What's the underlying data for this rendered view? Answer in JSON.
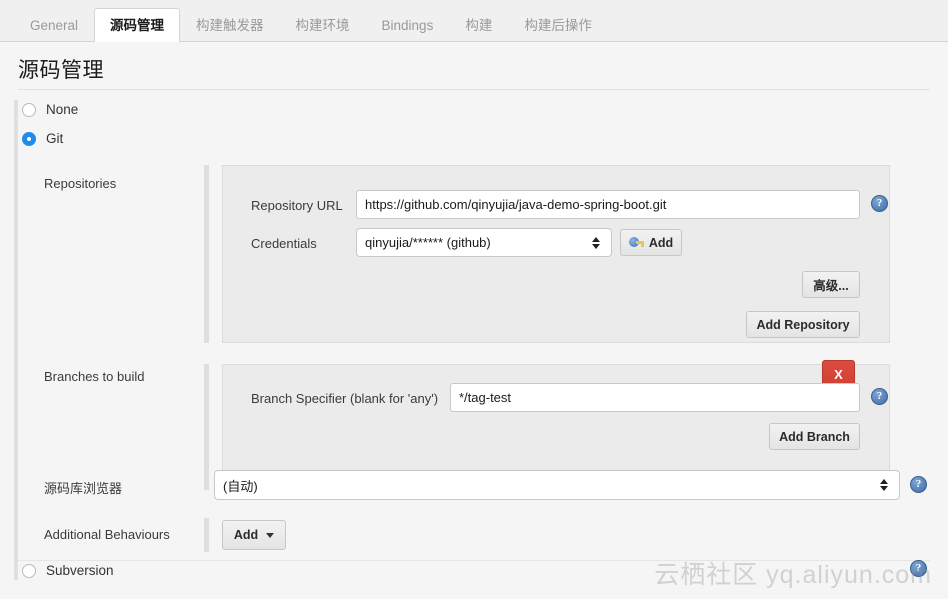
{
  "tabs": [
    {
      "label": "General",
      "active": false
    },
    {
      "label": "源码管理",
      "active": true
    },
    {
      "label": "构建触发器",
      "active": false
    },
    {
      "label": "构建环境",
      "active": false
    },
    {
      "label": "Bindings",
      "active": false
    },
    {
      "label": "构建",
      "active": false
    },
    {
      "label": "构建后操作",
      "active": false
    }
  ],
  "page": {
    "title": "源码管理"
  },
  "scm": {
    "options": [
      {
        "label": "None",
        "selected": false
      },
      {
        "label": "Git",
        "selected": true
      },
      {
        "label": "Subversion",
        "selected": false
      }
    ]
  },
  "repositories": {
    "label": "Repositories",
    "url_label": "Repository URL",
    "url_value": "https://github.com/qinyujia/java-demo-spring-boot.git",
    "credentials_label": "Credentials",
    "credentials_value": "qinyujia/****** (github)",
    "add_credentials_label": "Add",
    "advanced_label": "高级...",
    "add_repository_label": "Add Repository"
  },
  "branches": {
    "label": "Branches to build",
    "specifier_label": "Branch Specifier (blank for 'any')",
    "specifier_value": "*/tag-test",
    "delete_label": "X",
    "add_branch_label": "Add Branch"
  },
  "browser": {
    "label": "源码库浏览器",
    "value": "(自动)"
  },
  "behaviours": {
    "label": "Additional Behaviours",
    "add_label": "Add"
  },
  "help": {
    "glyph": "?"
  },
  "watermark": {
    "text": "云栖社区 yq.aliyun.com"
  },
  "colors": {
    "accent": "#1f8ced",
    "danger": "#cf4134",
    "panel": "#ebebeb",
    "page": "#f5f5f5"
  }
}
